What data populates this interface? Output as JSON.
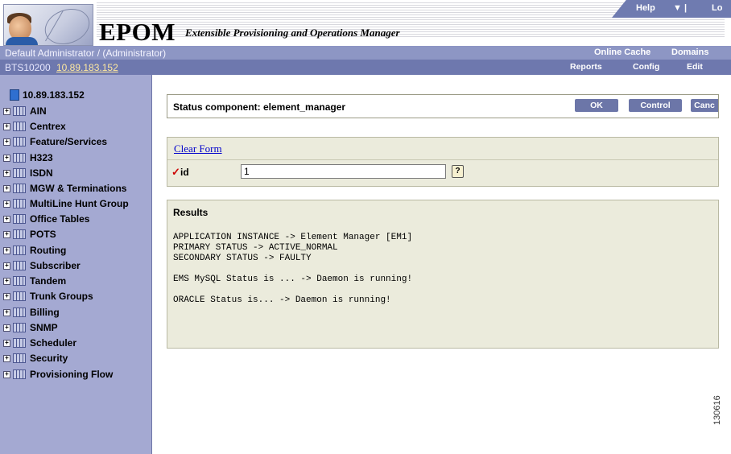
{
  "header": {
    "brand": "EPOM",
    "brand_subtitle": "Extensible Provisioning and Operations Manager",
    "help_label": "Help",
    "menu_arrow": "▼ |",
    "logout_label": "Lo"
  },
  "user_bar": {
    "user": "Default Administrator / (Administrator)",
    "online_cache": "Online Cache",
    "domains": "Domains"
  },
  "ip_bar": {
    "system": "BTS10200",
    "ip": "10.89.183.152",
    "reports": "Reports",
    "config": "Config",
    "edit": "Edit"
  },
  "sidebar": {
    "root": "10.89.183.152",
    "items": [
      {
        "label": "AIN"
      },
      {
        "label": "Centrex"
      },
      {
        "label": "Feature/Services"
      },
      {
        "label": "H323"
      },
      {
        "label": "ISDN"
      },
      {
        "label": "MGW & Terminations"
      },
      {
        "label": "MultiLine Hunt Group"
      },
      {
        "label": "Office Tables"
      },
      {
        "label": "POTS"
      },
      {
        "label": "Routing"
      },
      {
        "label": "Subscriber"
      },
      {
        "label": "Tandem"
      },
      {
        "label": "Trunk Groups"
      },
      {
        "label": "Billing"
      },
      {
        "label": "SNMP"
      },
      {
        "label": "Scheduler"
      },
      {
        "label": "Security"
      },
      {
        "label": "Provisioning Flow"
      }
    ]
  },
  "status": {
    "title": "Status component: element_manager",
    "ok": "OK",
    "control": "Control",
    "cancel": "Canc"
  },
  "form": {
    "clear": "Clear Form",
    "required_mark": "✓",
    "id_label": "id",
    "id_value": "1",
    "help_glyph": "?"
  },
  "results": {
    "title": "Results",
    "lines": [
      "APPLICATION INSTANCE -> Element Manager [EM1]",
      "PRIMARY STATUS -> ACTIVE_NORMAL",
      "SECONDARY STATUS -> FAULTY",
      "",
      "EMS MySQL Status is ... -> Daemon is running!",
      "",
      "ORACLE Status is... -> Daemon is running!"
    ]
  },
  "figure_number": "130616",
  "colors": {
    "sidebar_bg": "#a4a9d2",
    "nav_bar": "#6e78ae",
    "panel_bg": "#ebebdc",
    "button": "#6c76a8",
    "link": "#0000cc"
  }
}
